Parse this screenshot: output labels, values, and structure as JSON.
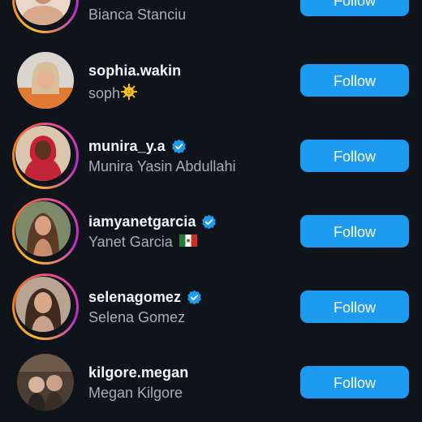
{
  "follow_label": "Follow",
  "accent_color": "#1d9bf0",
  "users": [
    {
      "username": "",
      "full_name": "Bianca Stanciu",
      "verified": true,
      "story_ring": true,
      "emoji": ""
    },
    {
      "username": "sophia.wakin",
      "full_name": "soph",
      "verified": false,
      "story_ring": false,
      "emoji": "sun-emoji"
    },
    {
      "username": "munira_y.a",
      "full_name": "Munira Yasin Abdullahi",
      "verified": true,
      "story_ring": true,
      "emoji": ""
    },
    {
      "username": "iamyanetgarcia",
      "full_name": "Yanet Garcia",
      "verified": true,
      "story_ring": true,
      "emoji": "mexico-flag-emoji"
    },
    {
      "username": "selenagomez",
      "full_name": "Selena Gomez",
      "verified": true,
      "story_ring": true,
      "emoji": ""
    },
    {
      "username": "kilgore.megan",
      "full_name": "Megan Kilgore",
      "verified": false,
      "story_ring": false,
      "emoji": ""
    }
  ]
}
